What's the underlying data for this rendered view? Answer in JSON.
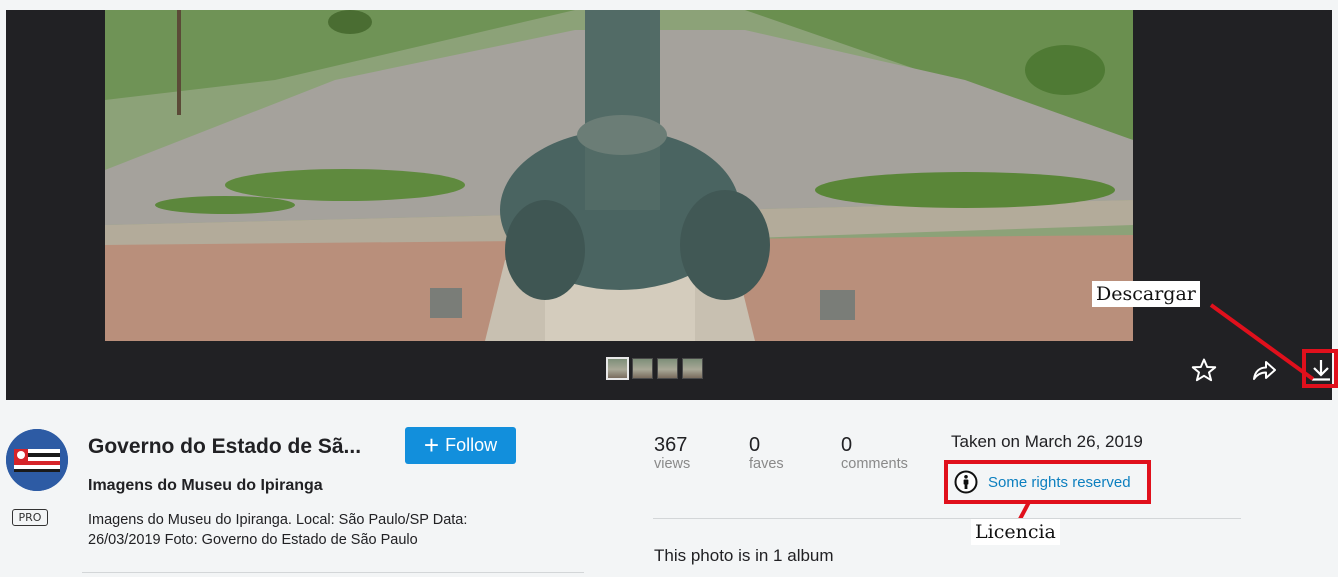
{
  "author": {
    "name": "Governo do Estado de Sã...",
    "badge": "PRO"
  },
  "follow_button": {
    "label": "Follow"
  },
  "photo": {
    "title": "Imagens do Museu do Ipiranga",
    "description": "Imagens do Museu do Ipiranga. Local: São Paulo/SP Data: 26/03/2019 Foto: Governo do Estado de São Paulo"
  },
  "stats": [
    {
      "value": "367",
      "label": "views"
    },
    {
      "value": "0",
      "label": "faves"
    },
    {
      "value": "0",
      "label": "comments"
    }
  ],
  "taken": "Taken on March 26, 2019",
  "license": {
    "text": "Some rights reserved",
    "icon": "creative-commons-by-icon"
  },
  "album": "This photo is in 1 album",
  "annotations": {
    "download": "Descargar",
    "license": "Licencia"
  },
  "toolbar": {
    "fave_icon": "star-icon",
    "share_icon": "share-arrow-icon",
    "download_icon": "download-icon"
  },
  "thumbnails": 4,
  "colors": {
    "stage": "#212124",
    "accent": "#128fdc",
    "link": "#0c7fbf",
    "callout": "#e0101c"
  }
}
